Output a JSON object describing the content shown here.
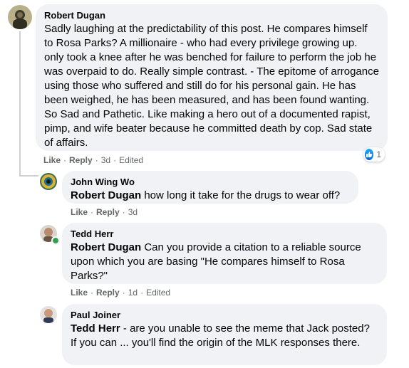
{
  "comments": [
    {
      "author": "Robert Dugan",
      "mention": "",
      "text": "Sadly laughing at the predictability of this post. He compares himself to Rosa Parks? A millionaire - who had every privilege growing up. only took a knee after he was benched for failure to perform the job he was overpaid to do. Really simple contrast. - The epitome of arrogance using those who suffered and still do for his personal gain. He has been weighed, he has been measured, and has been found wanting. So Sad and Pathetic. Like making a hero out of a documented rapist, pimp, and wife beater because he committed death by cop. Sad state of affairs.",
      "like": "Like",
      "reply": "Reply",
      "time": "3d",
      "edited": "Edited",
      "reaction_count": "1",
      "reaction_color": "#1877f2"
    },
    {
      "author": "John Wing Wo",
      "mention": "Robert Dugan",
      "text": "how long it take for the drugs to wear off?",
      "like": "Like",
      "reply": "Reply",
      "time": "3d"
    },
    {
      "author": "Tedd Herr",
      "mention": "Robert Dugan",
      "text": "Can you provide a citation to a reliable source upon which you are basing \"He compares himself to Rosa Parks?\"",
      "like": "Like",
      "reply": "Reply",
      "time": "1d",
      "edited": "Edited",
      "online_color": "#31a24c"
    },
    {
      "author": "Paul Joiner",
      "mention": "Tedd Herr",
      "text": "- are you unable to see the meme that Jack posted? If you can ... you'll find the origin of the MLK responses there."
    }
  ]
}
